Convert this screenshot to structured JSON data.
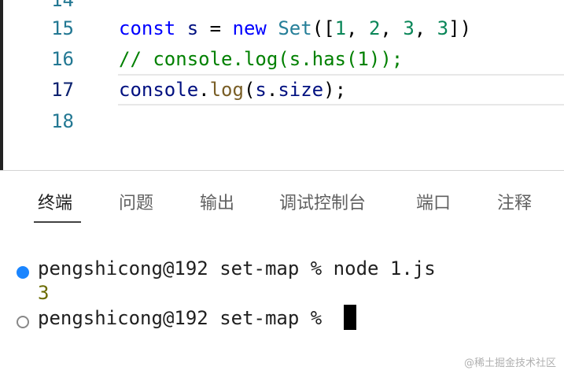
{
  "editor": {
    "lines": [
      {
        "number": "15",
        "tokens": {
          "kw_const": "const",
          "s": "s",
          "eq": "=",
          "kw_new": "new",
          "cls": "Set",
          "open": "([",
          "n1": "1",
          "c1": ",",
          "n2": "2",
          "c2": ",",
          "n3": "3",
          "c3": ",",
          "n4": "3",
          "close": "])"
        }
      },
      {
        "number": "16",
        "comment": "// console.log(s.has(1));"
      },
      {
        "number": "17",
        "tokens": {
          "console": "console",
          "dot1": ".",
          "log": "log",
          "open": "(",
          "s": "s",
          "dot2": ".",
          "size": "size",
          "close": ");"
        }
      },
      {
        "number": "18"
      }
    ]
  },
  "panel": {
    "tabs": [
      "终端",
      "问题",
      "输出",
      "调试控制台",
      "端口",
      "注释"
    ],
    "active_tab": "终端"
  },
  "terminal": {
    "lines": [
      {
        "prompt": "pengshicong@192 set-map % node 1.js"
      },
      {
        "output": "3"
      },
      {
        "prompt": "pengshicong@192 set-map % "
      }
    ]
  },
  "colors": {
    "keyword": "#0000ff",
    "class": "#267f99",
    "number": "#098658",
    "comment": "#008000",
    "line_number": "#237893",
    "terminal_success_dot": "#1a85ff"
  },
  "watermark": "@稀土掘金技术社区"
}
